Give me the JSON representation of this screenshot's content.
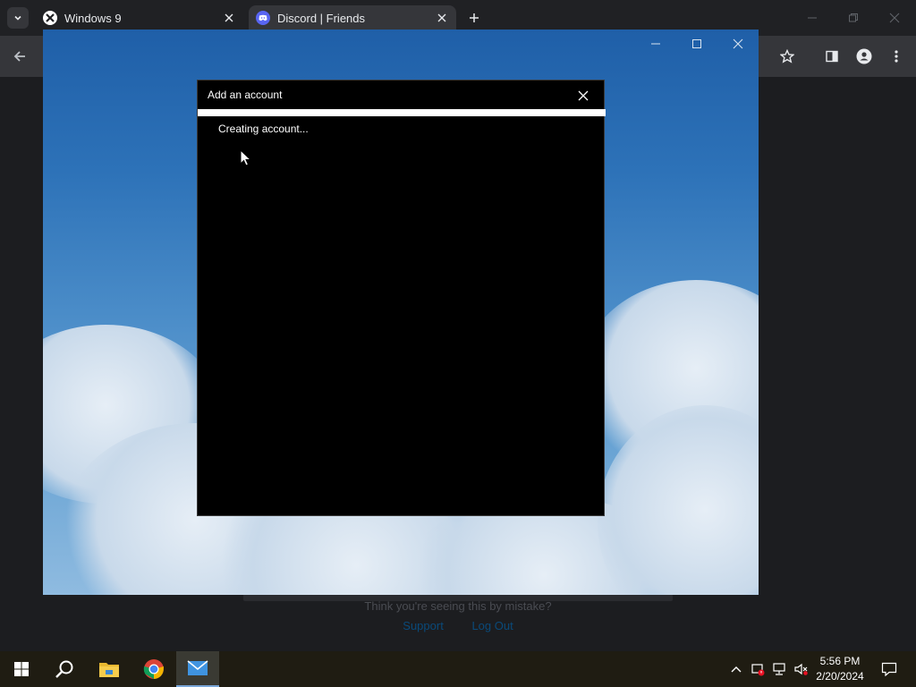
{
  "browser": {
    "tabs": [
      {
        "title": "Windows 9",
        "icon": "windows9-icon",
        "active": false
      },
      {
        "title": "Discord | Friends",
        "icon": "discord-icon",
        "active": true
      }
    ]
  },
  "page": {
    "hint_text": "Think you're seeing this by mistake?",
    "links": [
      "Support",
      "Log Out"
    ]
  },
  "dialog": {
    "title": "Add an account",
    "status": "Creating account...",
    "progress": 1.0
  },
  "taskbar": {
    "apps": [
      "start-icon",
      "search-icon",
      "file-explorer-icon",
      "chrome-icon",
      "mail-icon"
    ],
    "active_app": "mail-icon",
    "time": "5:56 PM",
    "date": "2/20/2024"
  },
  "colors": {
    "dialog_bg": "#000000",
    "progress": "#ffffff",
    "discord": "#5865f2",
    "taskbar": "#1f1c12"
  }
}
